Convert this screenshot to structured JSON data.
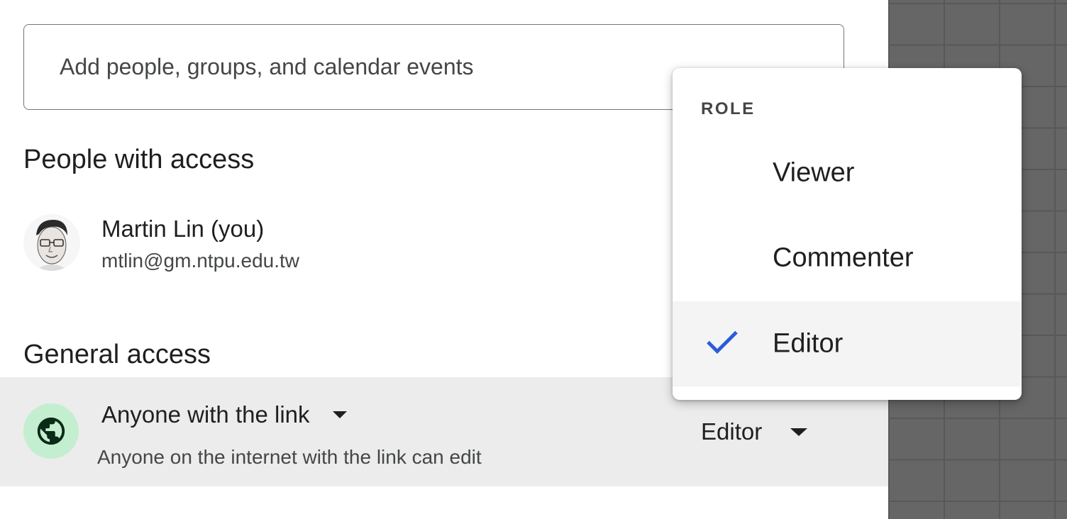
{
  "share": {
    "add_placeholder": "Add people, groups, and calendar events"
  },
  "people_section": {
    "title": "People with access",
    "people": [
      {
        "name": "Martin Lin (you)",
        "email": "mtlin@gm.ntpu.edu.tw"
      }
    ]
  },
  "general_access": {
    "title": "General access",
    "link_option": "Anyone with the link",
    "description": "Anyone on the internet with the link can edit",
    "role": "Editor",
    "icon": "globe-icon"
  },
  "role_menu": {
    "header": "ROLE",
    "items": [
      {
        "label": "Viewer",
        "selected": false
      },
      {
        "label": "Commenter",
        "selected": false
      },
      {
        "label": "Editor",
        "selected": true
      }
    ]
  },
  "colors": {
    "check": "#2b5bd7",
    "globe_bg": "#c4eed0",
    "row_highlight": "#ececec"
  }
}
